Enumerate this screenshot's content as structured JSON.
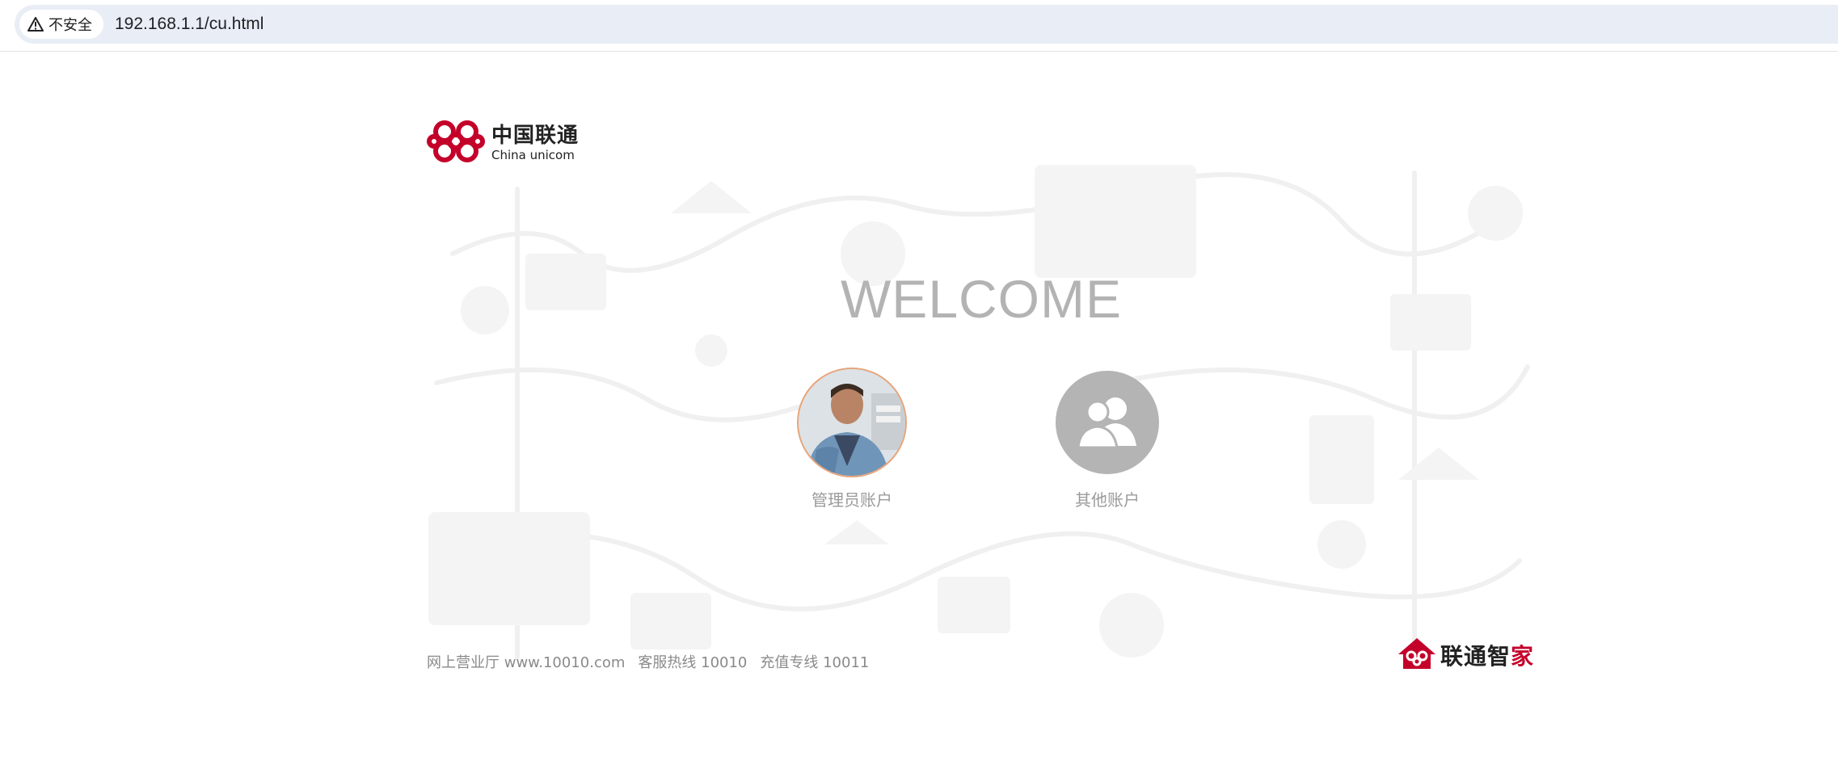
{
  "browser": {
    "security_label": "不安全",
    "url": "192.168.1.1/cu.html",
    "icons": [
      "warning-triangle-icon"
    ]
  },
  "brand": {
    "name_cn": "中国联通",
    "name_en": "China unicom",
    "logo_color": "#c4002a"
  },
  "main": {
    "heading": "WELCOME",
    "accounts": [
      {
        "label": "管理员账户",
        "avatar": "admin-photo"
      },
      {
        "label": "其他账户",
        "avatar": "users-icon"
      }
    ]
  },
  "footer": {
    "links": [
      "网上营业厅 www.10010.com",
      "客服热线 10010",
      "充值专线 10011"
    ],
    "smart_home_prefix": "联通智",
    "smart_home_suffix": "家"
  },
  "colors": {
    "accent": "#c4002a",
    "heading": "#b3b3b3",
    "avatar_gray": "#b4b4b4"
  }
}
